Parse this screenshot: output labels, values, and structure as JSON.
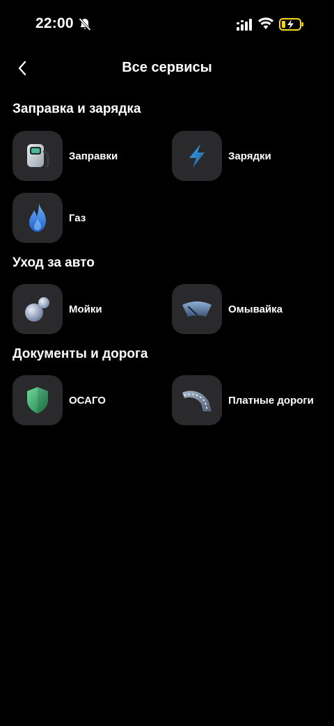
{
  "status_bar": {
    "time": "22:00",
    "icons": [
      "bell-off-icon",
      "signal-icon",
      "wifi-icon",
      "battery-charging-icon"
    ]
  },
  "header": {
    "title": "Все сервисы",
    "back_icon": "chevron-left-icon"
  },
  "sections": [
    {
      "title": "Заправка и зарядка",
      "items": [
        {
          "label": "Заправки",
          "icon": "fuel-pump-icon"
        },
        {
          "label": "Зарядки",
          "icon": "lightning-icon"
        },
        {
          "label": "Газ",
          "icon": "gas-flame-icon"
        }
      ]
    },
    {
      "title": "Уход за авто",
      "items": [
        {
          "label": "Мойки",
          "icon": "bubbles-icon"
        },
        {
          "label": "Омывайка",
          "icon": "windshield-icon"
        }
      ]
    },
    {
      "title": "Документы и дорога",
      "items": [
        {
          "label": "ОСАГО",
          "icon": "shield-icon"
        },
        {
          "label": "Платные дороги",
          "icon": "road-icon"
        }
      ]
    }
  ],
  "colors": {
    "background": "#000000",
    "tile": "#2a2a2c",
    "text": "#ffffff",
    "lightning": "#2b8fd6",
    "flame": "#3a7de0",
    "shield": "#3fae74",
    "battery_accent": "#f5d90a"
  }
}
